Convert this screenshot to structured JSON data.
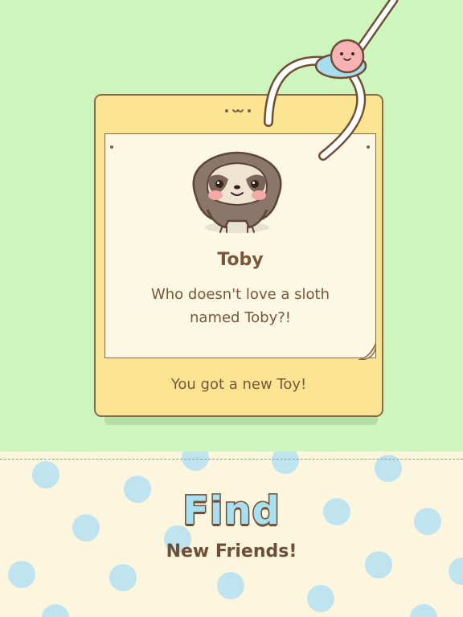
{
  "card": {
    "toy_name": "Toby",
    "description_lines": [
      "Who doesn't love a sloth",
      "named Toby?!"
    ],
    "reward_message": "You got a new Toy!"
  },
  "promo": {
    "headline": "Find",
    "subheadline": "New Friends!"
  },
  "colors": {
    "top_background": "#cdf5bd",
    "bottom_background": "#fcf6df",
    "card_yellow": "#fce592",
    "text_brown": "#7a5639",
    "headline_blue": "#a8dff2",
    "polka_dot": "#bfe3ef"
  },
  "icons": {
    "toy": "sloth-icon",
    "claw": "claw-machine-icon",
    "card_face": "smiley-face-icon"
  }
}
